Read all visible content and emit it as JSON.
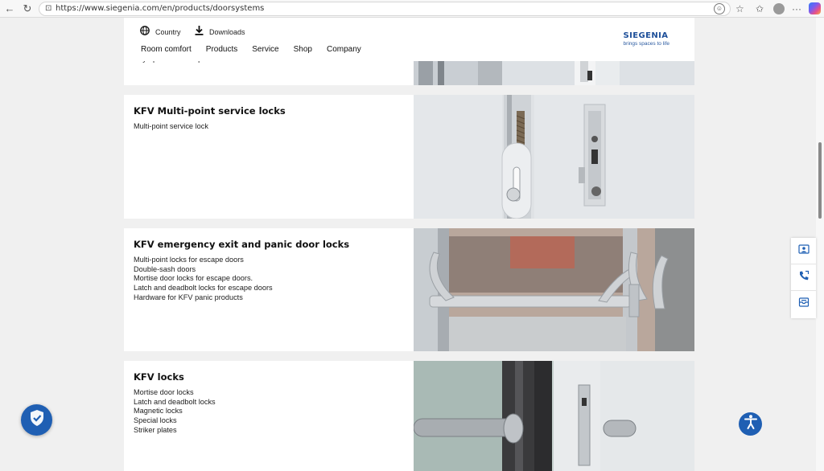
{
  "browser": {
    "url": "https://www.siegenia.com/en/products/doorsystems",
    "back_glyph": "←",
    "reload_glyph": "↻",
    "lock_glyph": "🔒",
    "reader_glyph": "☺",
    "favorite_glyph": "☆",
    "collections_glyph": "☆",
    "more_glyph": "···"
  },
  "header": {
    "country_label": "Country",
    "downloads_label": "Downloads",
    "nav": [
      "Room comfort",
      "Products",
      "Service",
      "Shop",
      "Company"
    ],
    "logo": {
      "brand": "SIEGENIA",
      "tagline": "brings spaces to life"
    }
  },
  "cards": [
    {
      "title": "",
      "items": [
        "Key-operated multi-point locks"
      ]
    },
    {
      "title": "KFV Multi-point service locks",
      "items": [
        "Multi-point service lock"
      ]
    },
    {
      "title": "KFV emergency exit and panic door locks",
      "items": [
        "Multi-point locks for escape doors",
        "Double-sash doors",
        "Mortise door locks for escape doors.",
        "Latch and deadbolt locks for escape doors",
        "Hardware for KFV panic products"
      ]
    },
    {
      "title": "KFV locks",
      "items": [
        "Mortise door locks",
        "Latch and deadbolt locks",
        "Magnetic locks",
        "Special locks",
        "Striker plates"
      ]
    }
  ],
  "colors": {
    "brand": "#1d4f99",
    "badge": "#1f5fb3"
  },
  "icons": {
    "country": "globe-icon",
    "downloads": "download-icon",
    "contact": "contact-card-icon",
    "phone": "phone-icon",
    "mail": "mail-icon",
    "privacy": "shield-check-icon",
    "accessibility": "accessibility-icon"
  }
}
